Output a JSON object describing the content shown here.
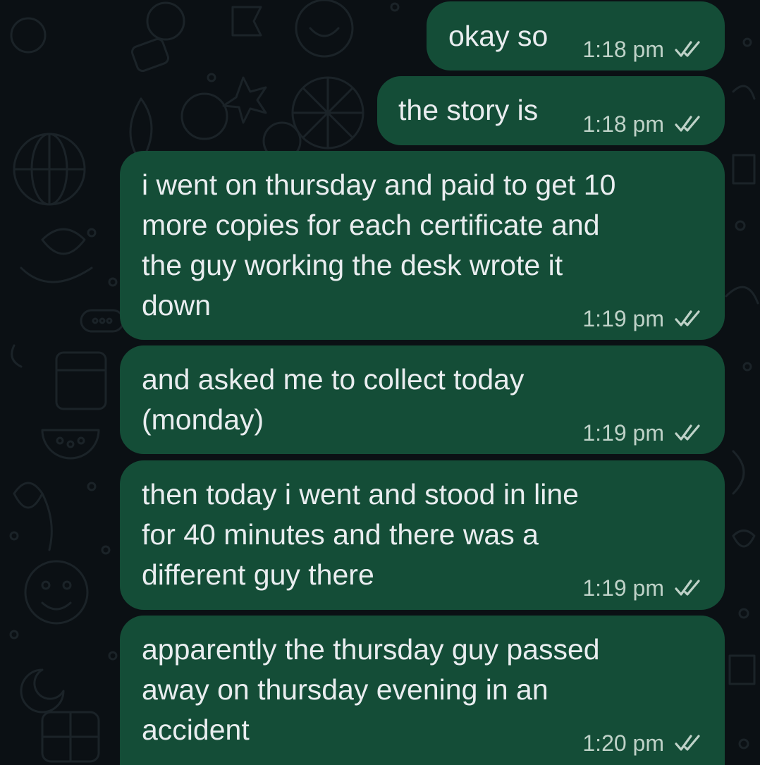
{
  "theme": {
    "background": "#0b1014",
    "bubble_color": "#144d37",
    "text_color": "#e9edef",
    "meta_color": "#bfd2c8"
  },
  "messages": [
    {
      "text": "okay so",
      "time": "1:18 pm",
      "status_icon": "double-check-icon"
    },
    {
      "text": "the story is",
      "time": "1:18 pm",
      "status_icon": "double-check-icon"
    },
    {
      "text": "i went on thursday and paid to get 10\nmore copies for each certificate and\nthe guy working the desk wrote it\ndown",
      "time": "1:19 pm",
      "status_icon": "double-check-icon"
    },
    {
      "text": "and asked me to collect today\n(monday)",
      "time": "1:19 pm",
      "status_icon": "double-check-icon"
    },
    {
      "text": "then today i went and stood in line\nfor 40 minutes and there was a\ndifferent guy there",
      "time": "1:19 pm",
      "status_icon": "double-check-icon"
    },
    {
      "text": "apparently the thursday guy passed\naway on thursday evening in an\naccident",
      "time": "1:20 pm",
      "status_icon": "double-check-icon"
    }
  ]
}
